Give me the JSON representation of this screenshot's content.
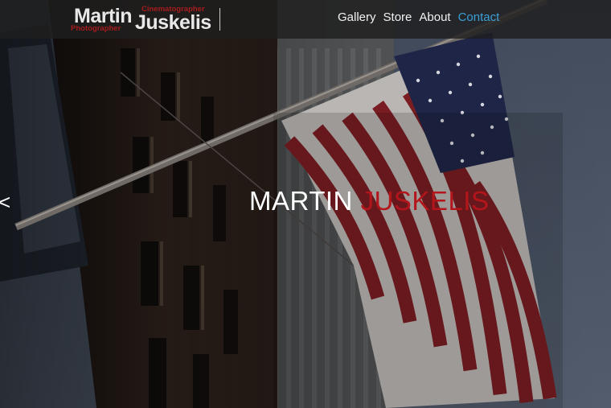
{
  "header": {
    "logo": {
      "first_name": "Martin",
      "last_name": "Juskelis",
      "tag_top": "Cinematographer",
      "tag_bottom": "Photographer"
    },
    "nav": [
      {
        "label": "Gallery",
        "active": false
      },
      {
        "label": "Store",
        "active": false
      },
      {
        "label": "About",
        "active": false
      },
      {
        "label": "Contact",
        "active": true
      }
    ]
  },
  "hero": {
    "first_name": "MARTIN",
    "last_name": "JUSKELIS",
    "prev_arrow": "<"
  },
  "colors": {
    "accent_red": "#b3151b",
    "active_link": "#3aa0d8",
    "header_bg": "#1e1e1e"
  }
}
